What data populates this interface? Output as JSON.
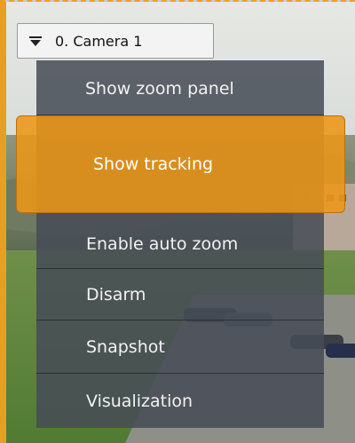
{
  "camera_selector": {
    "label": "0. Camera 1",
    "icon": "dropdown-arrow-icon"
  },
  "context_menu": {
    "items": [
      {
        "label": "Show zoom panel"
      },
      {
        "label": "Show tracking",
        "highlighted": true
      },
      {
        "label": "Enable auto zoom"
      },
      {
        "label": "Disarm"
      },
      {
        "label": "Snapshot"
      },
      {
        "label": "Visualization"
      }
    ]
  },
  "colors": {
    "highlight": "#ec9616",
    "menu_background": "#464c56",
    "frame_border": "#e89f20"
  }
}
